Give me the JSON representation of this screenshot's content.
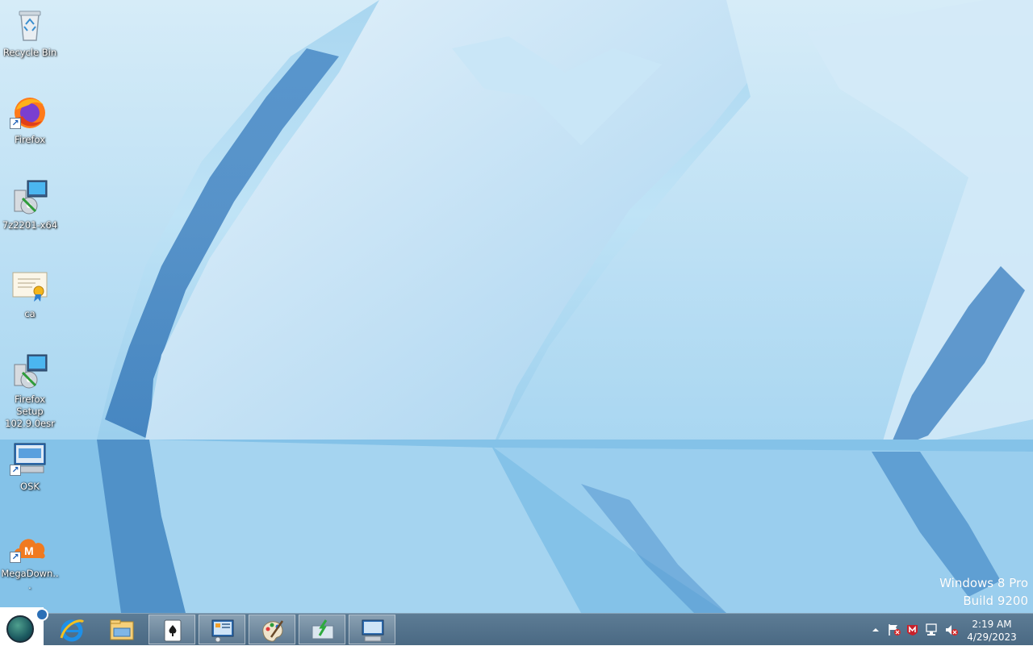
{
  "desktop": {
    "icons": [
      {
        "label": "Recycle Bin",
        "icon": "recycle-bin-icon"
      },
      {
        "label": "Firefox",
        "icon": "firefox-icon"
      },
      {
        "label": "7z2201-x64",
        "icon": "installer-icon"
      },
      {
        "label": "ca",
        "icon": "certificate-icon"
      },
      {
        "label": "Firefox Setup 102.9.0esr",
        "icon": "installer-icon"
      },
      {
        "label": "OSK",
        "icon": "on-screen-keyboard-icon"
      },
      {
        "label": "MegaDown...",
        "icon": "mega-downloader-icon"
      }
    ]
  },
  "watermark": {
    "edition": "Windows 8 Pro",
    "build": "Build 9200"
  },
  "taskbar": {
    "buttons": [
      {
        "name": "internet-explorer-icon"
      },
      {
        "name": "file-explorer-icon"
      },
      {
        "name": "solitaire-icon"
      },
      {
        "name": "control-panel-icon"
      },
      {
        "name": "paint-icon"
      },
      {
        "name": "network-download-icon"
      },
      {
        "name": "remote-desktop-icon"
      }
    ],
    "tray": {
      "icons": [
        "show-hidden-icons-icon",
        "action-center-flag-icon",
        "antivirus-alert-icon",
        "network-icon",
        "volume-muted-icon"
      ]
    },
    "clock": {
      "time": "2:19 AM",
      "date": "4/29/2023"
    }
  },
  "colors": {
    "taskbar": "#4f6e88",
    "label_text": "#ffffff"
  }
}
